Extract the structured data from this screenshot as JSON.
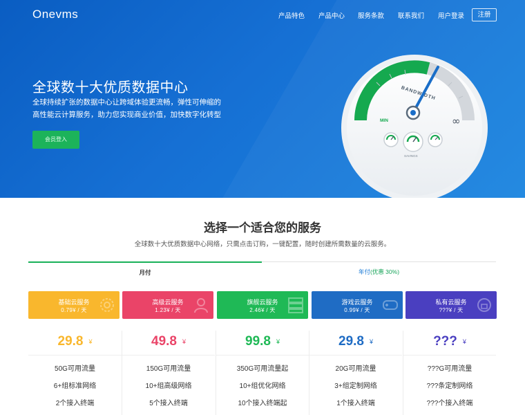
{
  "header": {
    "logo": "Onevms",
    "nav": [
      "产品特色",
      "产品中心",
      "服务条款",
      "联系我们",
      "用户登录"
    ],
    "register": "注册"
  },
  "hero": {
    "title": "全球数十大优质数据中心",
    "desc_line1": "全球持续扩张的数据中心让跨域体验更流畅，弹性可伸缩的",
    "desc_line2": "高性能云计算服务，助力您实现商业价值，加快数字化转型",
    "button": "会员登入",
    "gauge": {
      "label": "BANDWIDTH",
      "min": "MIN",
      "max": "∞",
      "savings": "SAVINGS"
    }
  },
  "plans": {
    "title": "选择一个适合您的服务",
    "subtitle": "全球数十大优质数据中心网络，只需点击订购，一键配置，随时创建所需数量的云服务。",
    "tab_monthly": "月付",
    "tab_yearly_prefix": "年付",
    "tab_yearly_discount": "(优惠 30%)",
    "cards": [
      {
        "name": "基础云服务",
        "price": "0.79¥ / 天",
        "color": "#f9b72d"
      },
      {
        "name": "高级云服务",
        "price": "1.23¥ / 天",
        "color": "#ea4468"
      },
      {
        "name": "旗舰云服务",
        "price": "2.46¥ / 天",
        "color": "#1fb956"
      },
      {
        "name": "游戏云服务",
        "price": "0.99¥ / 天",
        "color": "#1f6cc4"
      },
      {
        "name": "私有云服务",
        "price": "???¥ / 天",
        "color": "#4a3fc0"
      }
    ],
    "columns": [
      {
        "price": "29.8",
        "unit": "¥",
        "color": "#f9b72d",
        "features": [
          "50G可用流量",
          "6+组标准网络",
          "2个接入终端"
        ]
      },
      {
        "price": "49.8",
        "unit": "¥",
        "color": "#ea4468",
        "features": [
          "150G可用流量",
          "10+组高级网络",
          "5个接入终端"
        ]
      },
      {
        "price": "99.8",
        "unit": "¥",
        "color": "#1fb956",
        "features": [
          "350G可用流量起",
          "10+组优化网络",
          "10个接入终端起"
        ]
      },
      {
        "price": "29.8",
        "unit": "¥",
        "color": "#1f6cc4",
        "features": [
          "20G可用流量",
          "3+组定制网络",
          "1个接入终端"
        ]
      },
      {
        "price": "???",
        "unit": "¥",
        "color": "#4a3fc0",
        "features": [
          "???G可用流量",
          "???条定制网络",
          "???个接入终端"
        ]
      }
    ]
  }
}
